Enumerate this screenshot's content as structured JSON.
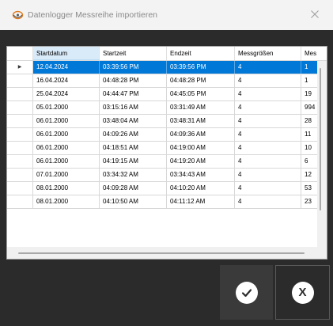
{
  "window": {
    "title": "Datenlogger Messreihe importieren",
    "close_symbol": "✕"
  },
  "grid": {
    "columns": [
      "",
      "Startdatum",
      "Startzeit",
      "Endzeit",
      "Messgrößen",
      "Mes"
    ],
    "rows": [
      [
        "12.04.2024",
        "03:39:56 PM",
        "03:39:56 PM",
        "4",
        "1"
      ],
      [
        "16.04.2024",
        "04:48:28 PM",
        "04:48:28 PM",
        "4",
        "1"
      ],
      [
        "25.04.2024",
        "04:44:47 PM",
        "04:45:05 PM",
        "4",
        "19"
      ],
      [
        "05.01.2000",
        "03:15:16 AM",
        "03:31:49 AM",
        "4",
        "994"
      ],
      [
        "06.01.2000",
        "03:48:04 AM",
        "03:48:31 AM",
        "4",
        "28"
      ],
      [
        "06.01.2000",
        "04:09:26 AM",
        "04:09:36 AM",
        "4",
        "11"
      ],
      [
        "06.01.2000",
        "04:18:51 AM",
        "04:19:00 AM",
        "4",
        "10"
      ],
      [
        "06.01.2000",
        "04:19:15 AM",
        "04:19:20 AM",
        "4",
        "6"
      ],
      [
        "07.01.2000",
        "03:34:32 AM",
        "03:34:43 AM",
        "4",
        "12"
      ],
      [
        "08.01.2000",
        "04:09:28 AM",
        "04:10:20 AM",
        "4",
        "53"
      ],
      [
        "08.01.2000",
        "04:10:50 AM",
        "04:11:12 AM",
        "4",
        "23"
      ]
    ],
    "selected_row": 0,
    "current_row_marker": "▶"
  },
  "buttons": {
    "ok_icon": "check-icon",
    "cancel_label": "X"
  },
  "colors": {
    "selection": "#0078d7",
    "dialog_bg": "#2b2b2b",
    "button_bg": "#3a3a3a"
  }
}
